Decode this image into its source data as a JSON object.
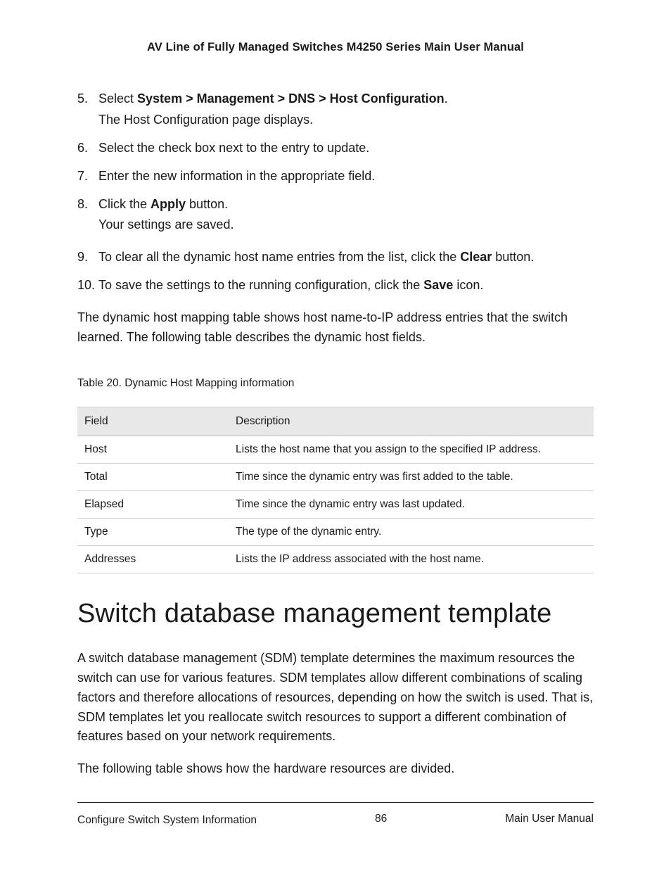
{
  "header": {
    "title": "AV Line of Fully Managed Switches M4250 Series Main User Manual"
  },
  "steps": [
    {
      "num": "5.",
      "prefix": "Select ",
      "bold": "System > Management > DNS > Host Configuration",
      "suffix": ".",
      "sub": "The Host Configuration page displays."
    },
    {
      "num": "6.",
      "prefix": "Select the check box next to the entry to update.",
      "bold": "",
      "suffix": "",
      "sub": ""
    },
    {
      "num": "7.",
      "prefix": "Enter the new information in the appropriate field.",
      "bold": "",
      "suffix": "",
      "sub": ""
    },
    {
      "num": "8.",
      "prefix": "Click the ",
      "bold": "Apply",
      "suffix": " button.",
      "sub": "Your settings are saved."
    },
    {
      "num": "9.",
      "prefix": "To clear all the dynamic host name entries from the list, click the ",
      "bold": "Clear",
      "suffix": " button.",
      "sub": ""
    },
    {
      "num": "10.",
      "prefix": "To save the settings to the running configuration, click the ",
      "bold": "Save",
      "suffix": " icon.",
      "sub": ""
    }
  ],
  "para1": "The dynamic host mapping table shows host name-to-IP address entries that the switch learned. The following table describes the dynamic host fields.",
  "table": {
    "caption": "Table 20. Dynamic Host Mapping information",
    "headers": [
      "Field",
      "Description"
    ],
    "rows": [
      [
        "Host",
        "Lists the host name that you assign to the specified IP address."
      ],
      [
        "Total",
        "Time since the dynamic entry was first added to the table."
      ],
      [
        "Elapsed",
        "Time since the dynamic entry was last updated."
      ],
      [
        "Type",
        "The type of the dynamic entry."
      ],
      [
        "Addresses",
        "Lists the IP address associated with the host name."
      ]
    ]
  },
  "section_heading": "Switch database management template",
  "para2": "A switch database management (SDM) template determines the maximum resources the switch can use for various features. SDM templates allow different combinations of scaling factors and therefore allocations of resources, depending on how the switch is used. That is, SDM templates let you reallocate switch resources to support a different combination of features based on your network requirements.",
  "para3": "The following table shows how the hardware resources are divided.",
  "footer": {
    "left": "Configure Switch System Information",
    "center": "86",
    "right": "Main User Manual"
  }
}
